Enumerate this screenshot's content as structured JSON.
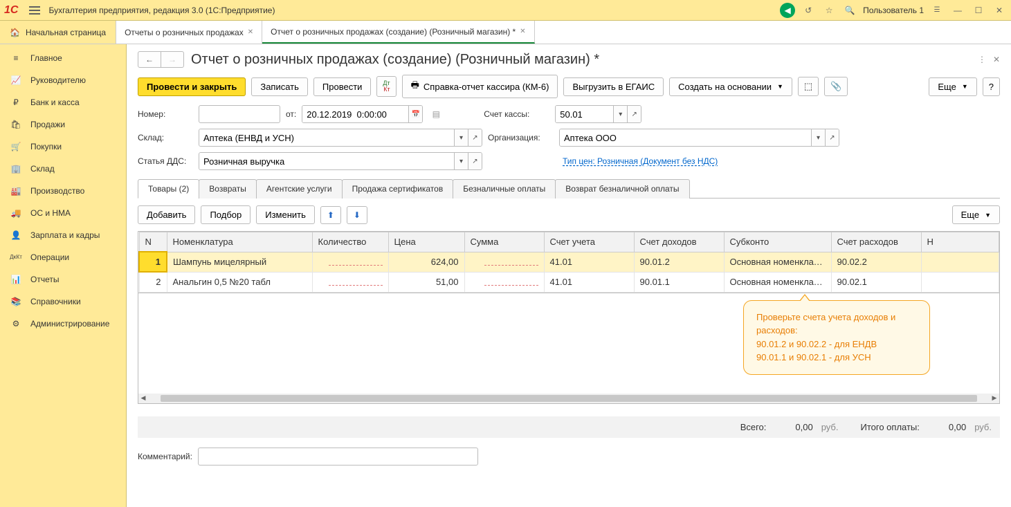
{
  "titlebar": {
    "app_name": "Бухгалтерия предприятия, редакция 3.0  (1С:Предприятие)",
    "user": "Пользователь 1"
  },
  "tabs": {
    "home": "Начальная страница",
    "t1": "Отчеты о розничных продажах",
    "t2": "Отчет о розничных продажах (создание) (Розничный магазин) *"
  },
  "sidebar": [
    {
      "icon": "≡",
      "label": "Главное"
    },
    {
      "icon": "📈",
      "label": "Руководителю"
    },
    {
      "icon": "₽",
      "label": "Банк и касса"
    },
    {
      "icon": "🛍",
      "label": "Продажи"
    },
    {
      "icon": "🛒",
      "label": "Покупки"
    },
    {
      "icon": "🏢",
      "label": "Склад"
    },
    {
      "icon": "🏭",
      "label": "Производство"
    },
    {
      "icon": "🚚",
      "label": "ОС и НМА"
    },
    {
      "icon": "👤",
      "label": "Зарплата и кадры"
    },
    {
      "icon": "ДᴋКᴛ",
      "label": "Операции"
    },
    {
      "icon": "📊",
      "label": "Отчеты"
    },
    {
      "icon": "📚",
      "label": "Справочники"
    },
    {
      "icon": "⚙",
      "label": "Администрирование"
    }
  ],
  "doc": {
    "title": "Отчет о розничных продажах (создание) (Розничный магазин) *",
    "toolbar": {
      "post_close": "Провести и закрыть",
      "save": "Записать",
      "post": "Провести",
      "report": "Справка-отчет кассира (КМ-6)",
      "egais": "Выгрузить в ЕГАИС",
      "create_based": "Создать на основании",
      "more": "Еще"
    },
    "fields": {
      "number_label": "Номер:",
      "number": "",
      "ot": "от:",
      "date": "20.12.2019  0:00:00",
      "cash_account_label": "Счет кассы:",
      "cash_account": "50.01",
      "warehouse_label": "Склад:",
      "warehouse": "Аптека (ЕНВД и УСН)",
      "org_label": "Организация:",
      "org": "Аптека ООО",
      "dds_label": "Статья ДДС:",
      "dds": "Розничная выручка",
      "price_type_link": "Тип цен: Розничная (Документ без НДС)"
    },
    "subtabs": {
      "goods": "Товары (2)",
      "returns": "Возвраты",
      "agent": "Агентские услуги",
      "cert": "Продажа сертификатов",
      "cashless": "Безналичные оплаты",
      "cashless_ret": "Возврат безналичной оплаты"
    },
    "subtoolbar": {
      "add": "Добавить",
      "pick": "Подбор",
      "edit": "Изменить",
      "more": "Еще"
    },
    "grid": {
      "headers": {
        "n": "N",
        "nomen": "Номенклатура",
        "qty": "Количество",
        "price": "Цена",
        "sum": "Сумма",
        "acc": "Счет учета",
        "income": "Счет доходов",
        "subc": "Субконто",
        "expense": "Счет расходов",
        "nalog": "Н"
      },
      "rows": [
        {
          "n": "1",
          "nomen": "Шампунь мицелярный",
          "qty": "",
          "price": "624,00",
          "sum": "",
          "acc": "41.01",
          "income": "90.01.2",
          "subc": "Основная номенклату...",
          "expense": "90.02.2"
        },
        {
          "n": "2",
          "nomen": "Анальгин 0,5 №20 табл",
          "qty": "",
          "price": "51,00",
          "sum": "",
          "acc": "41.01",
          "income": "90.01.1",
          "subc": "Основная номенклату...",
          "expense": "90.02.1"
        }
      ]
    },
    "tooltip": {
      "l1": "Проверьте счета учета доходов и расходов:",
      "l2": "90.01.2 и 90.02.2 - для ЕНДВ",
      "l3": "90.01.1 и 90.02.1 - для УСН"
    },
    "totals": {
      "all_label": "Всего:",
      "all_val": "0,00",
      "cur": "руб.",
      "paid_label": "Итого оплаты:",
      "paid_val": "0,00"
    },
    "comment_label": "Комментарий:"
  }
}
